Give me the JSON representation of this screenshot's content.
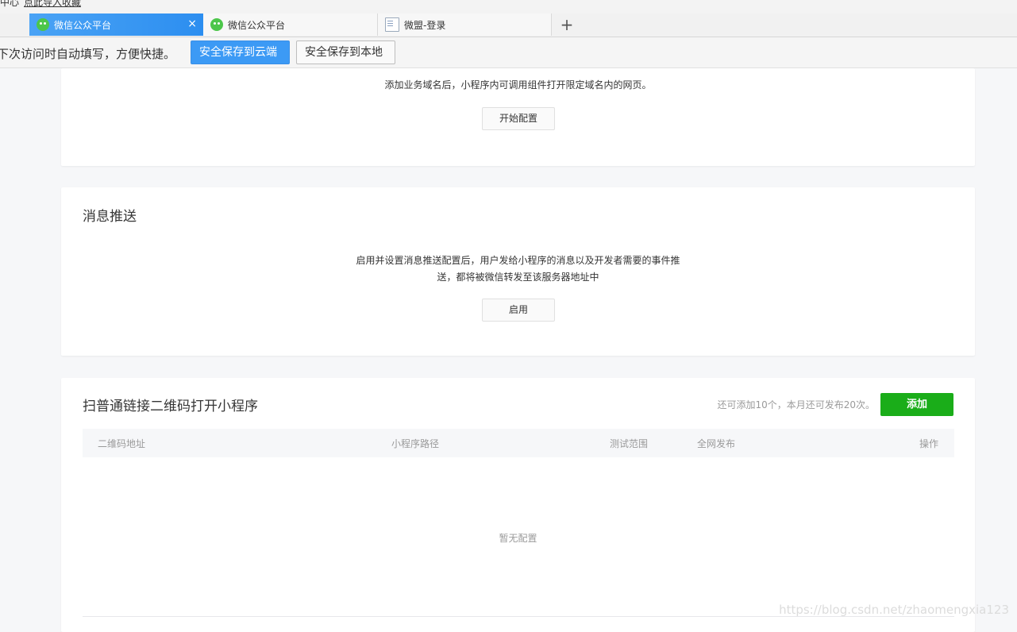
{
  "browser": {
    "bookmarks": {
      "left_text": "中心",
      "link_text": "点此导入收藏"
    },
    "tabs": [
      {
        "label": "微信公众平台",
        "active": true
      },
      {
        "label": "微信公众平台",
        "active": false
      },
      {
        "label": "微盟-登录",
        "active": false
      }
    ],
    "close_glyph": "×",
    "newtab_glyph": "+",
    "password_bar": {
      "text": "下次访问时自动填写，方便快捷。",
      "save_cloud": "安全保存到云端",
      "save_local": "安全保存到本地"
    }
  },
  "domain_section": {
    "description": "添加业务域名后，小程序内可调用组件打开限定域名内的网页。",
    "button": "开始配置"
  },
  "message_push": {
    "title": "消息推送",
    "description_line1": "启用并设置消息推送配置后，用户发给小程序的消息以及开发者需要的事件推",
    "description_line2": "送，都将被微信转发至该服务器地址中",
    "button": "启用"
  },
  "qrcode_section": {
    "title": "扫普通链接二维码打开小程序",
    "quota": "还可添加10个，本月还可发布20次。",
    "add_button": "添加",
    "columns": [
      "二维码地址",
      "小程序路径",
      "测试范围",
      "全网发布",
      "操作"
    ],
    "empty_text": "暂无配置"
  },
  "watermark": "https://blog.csdn.net/zhaomengxia123",
  "colors": {
    "primary_green": "#1aad19",
    "tab_blue": "#2c8ef0",
    "save_blue": "#3c9af5"
  }
}
